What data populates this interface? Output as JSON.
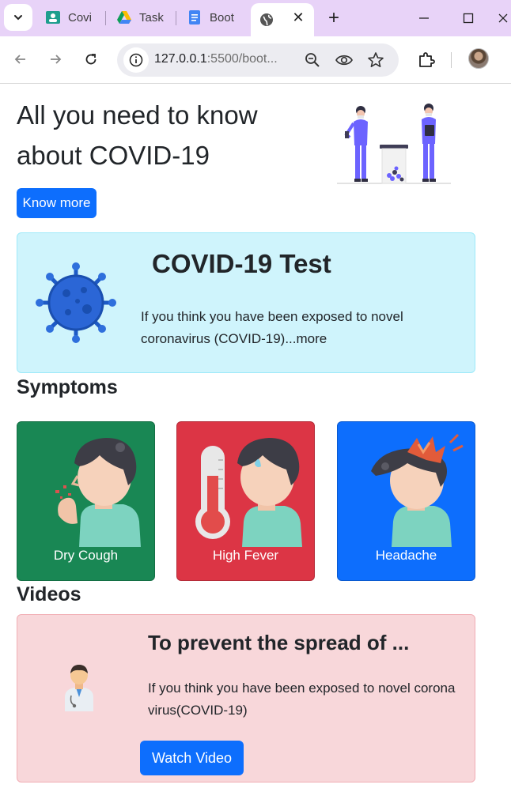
{
  "browser": {
    "tabs": [
      {
        "title": "Covi",
        "icon": "classroom-icon"
      },
      {
        "title": "Task",
        "icon": "drive-icon"
      },
      {
        "title": "Boot",
        "icon": "docs-icon"
      },
      {
        "title": "",
        "icon": "globe-icon",
        "active": true
      }
    ],
    "url_host": "127.0.0.1",
    "url_rest": ":5500/boot..."
  },
  "hero": {
    "title_line1": "All you need to know",
    "title_line2": "about COVID-19",
    "button_label": "Know more"
  },
  "test_card": {
    "title": "COVID-19 Test",
    "text": "If you think you have been exposed to novel coronavirus (COVID-19)...more"
  },
  "symptoms": {
    "heading": "Symptoms",
    "items": [
      {
        "label": "Dry Cough",
        "color": "#198754"
      },
      {
        "label": "High Fever",
        "color": "#dc3545"
      },
      {
        "label": "Headache",
        "color": "#0d6efd"
      }
    ]
  },
  "videos": {
    "heading": "Videos",
    "title": "To prevent the spread of ...",
    "text": "If you think you have been exposed to novel corona virus(COVID-19)",
    "button_label": "Watch Video"
  },
  "colors": {
    "primary": "#0d6efd",
    "info_bg": "#cff4fc",
    "danger_bg": "#f8d7da"
  }
}
